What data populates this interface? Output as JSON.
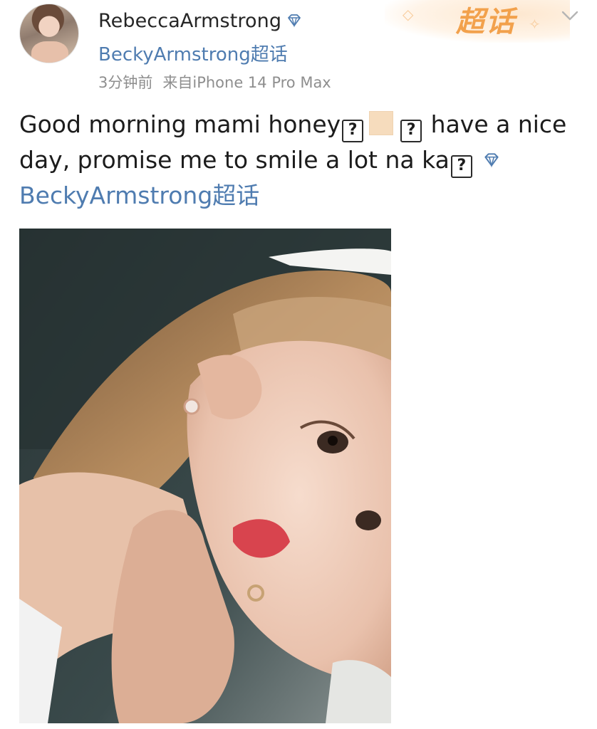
{
  "post": {
    "author": {
      "name": "RebeccaArmstrong",
      "supertopic": "BeckyArmstrong超话"
    },
    "meta": {
      "time": "3分钟前",
      "source": "来自iPhone 14 Pro Max"
    },
    "badge": {
      "label": "超话"
    },
    "content": {
      "part1": "Good morning mami honey",
      "box": "?",
      "part2": " have a nice day, promise me to smile a lot na ka",
      "topic_link": "BeckyArmstrong超话"
    }
  },
  "colors": {
    "link": "#4f7cb0",
    "badge": "#f2a14c",
    "meta": "#8e8e8e",
    "emoji_skin_tone": "#f6dcbd"
  },
  "icons": [
    "verified-diamond-icon",
    "chevron-down-icon",
    "photo"
  ]
}
